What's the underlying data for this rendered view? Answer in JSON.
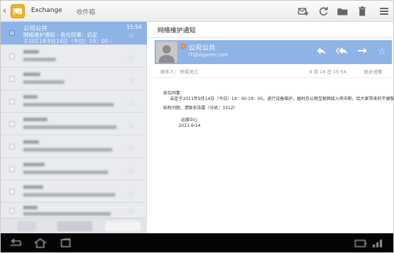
{
  "topbar": {
    "back_glyph": "‹",
    "account_name": "Exchange",
    "folder_name": "收件箱",
    "icons": [
      "compose-icon",
      "refresh-icon",
      "folder-icon",
      "trash-icon",
      "menu-icon"
    ]
  },
  "list": {
    "selected": {
      "sender": "公司公共",
      "time": "15:54",
      "subject": "网络维护通知 - 各位同事：启定",
      "snippet": "于2011年9月14日（今日）19：00 -"
    }
  },
  "message": {
    "title": "网络维护通知",
    "from_name": "公司公共",
    "from_email": "IT@zlgame.com",
    "to_label": "收件人：",
    "to_value": "所有员工",
    "date": "9 月 14 日 15:54",
    "details_label": "显示详情",
    "body": {
      "greeting": "各位同事：",
      "line1": "启定于2011年9月14日（今日）19：00-19：05，进行设备维护，届时办公网互联网接入将中断，给大家带来的不便敬请谅解。",
      "line2": "如有问题，请联系张磊（分机：3312）",
      "signature1": "运维中心",
      "signature2": "2011-9-14"
    }
  },
  "colors": {
    "accent": "#8eb3e6",
    "list_bg": "#e9ebee",
    "navbar": "#050505"
  }
}
